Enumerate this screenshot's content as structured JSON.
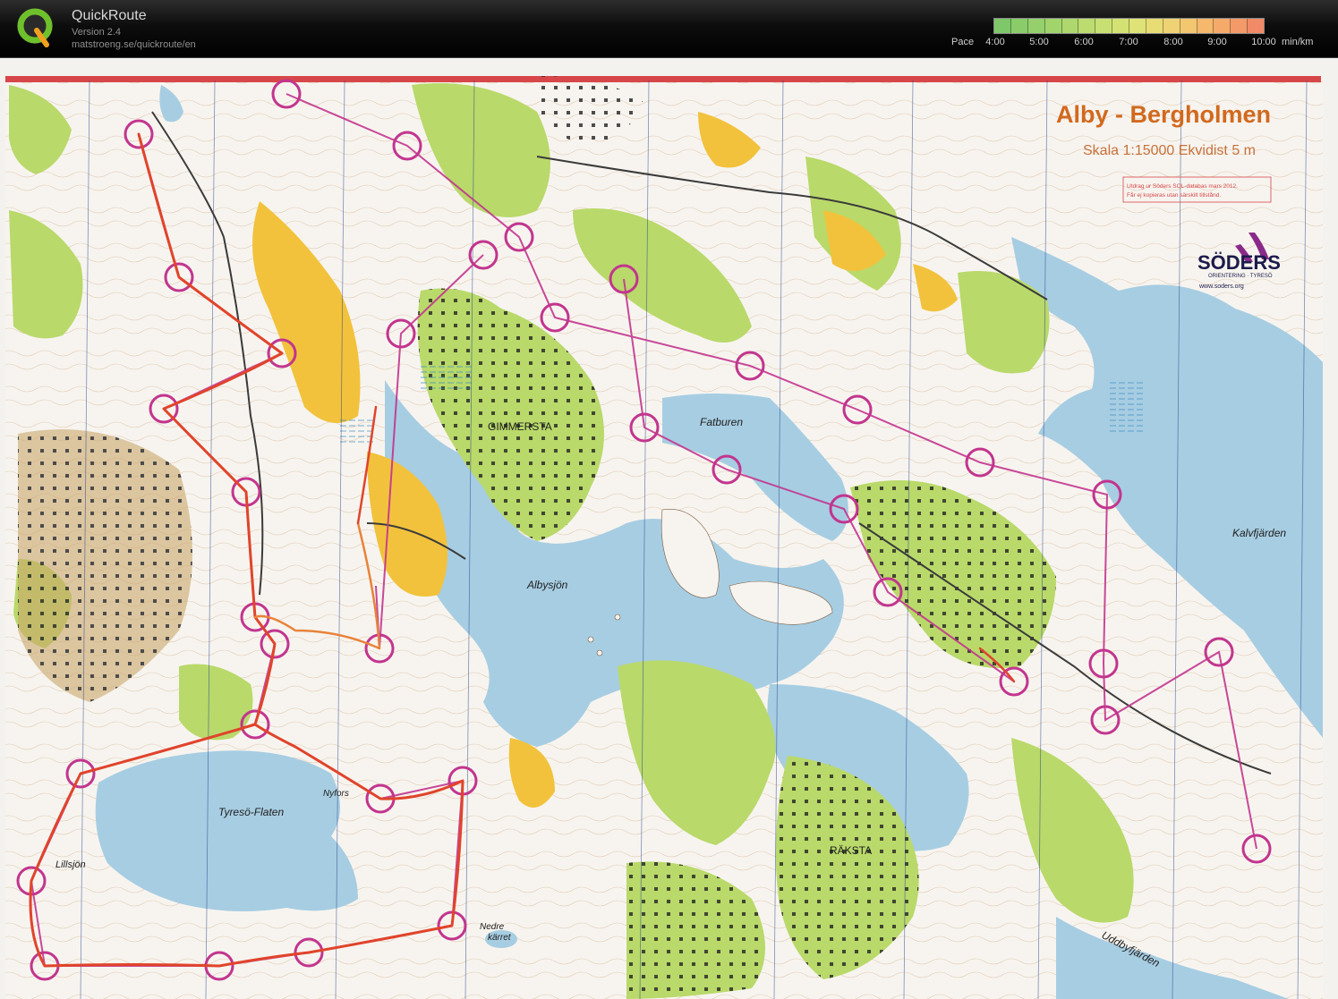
{
  "app": {
    "title": "QuickRoute",
    "version": "Version 2.4",
    "url": "matstroeng.se/quickroute/en",
    "logo_icon": "quickroute-q-logo"
  },
  "pace_scale": {
    "label": "Pace",
    "ticks": [
      "4:00",
      "5:00",
      "6:00",
      "7:00",
      "8:00",
      "9:00",
      "10:00"
    ],
    "unit": "min/km",
    "colors": [
      "#7ec86a",
      "#8acc6a",
      "#96d06c",
      "#a2d46c",
      "#aed86e",
      "#bcdc70",
      "#c8e072",
      "#d4e274",
      "#dfe276",
      "#e8dc74",
      "#efd274",
      "#f3c670",
      "#f5b86c",
      "#f6aa6a",
      "#f49a68",
      "#f18a66"
    ]
  },
  "map": {
    "title": "Alby - Bergholmen",
    "scale_text": "Skala 1:15000   Ekvidist 5 m",
    "copyright_line1": "Utdrag ur Söders SOL-databas mars 2012.",
    "copyright_line2": "Får ej kopieras utan särskilt tillstånd.",
    "club_name": "SÖDERS",
    "club_sub": "ORIENTERING · TYRESÖ",
    "club_url": "www.soders.org",
    "place_names": {
      "gimmersta": "GIMMERSTA",
      "fatburen": "Fatburen",
      "albysjon": "Albysjön",
      "kalvfjarden": "Kalvfjärden",
      "tyreso_flaten": "Tyresö-Flaten",
      "nyfors": "Nyfors",
      "lillsjon": "Lillsjön",
      "raksta": "RÄKSTA",
      "nedre_karret_1": "Nedre",
      "nedre_karret_2": "kärret",
      "uddbyfjarden": "Uddbyfjärden"
    },
    "colors": {
      "water": "#a7cde2",
      "forest_green": "#b9d96a",
      "open_yellow": "#f2c23c",
      "course_magenta": "#c2358e",
      "route_red": "#e0442b"
    }
  }
}
